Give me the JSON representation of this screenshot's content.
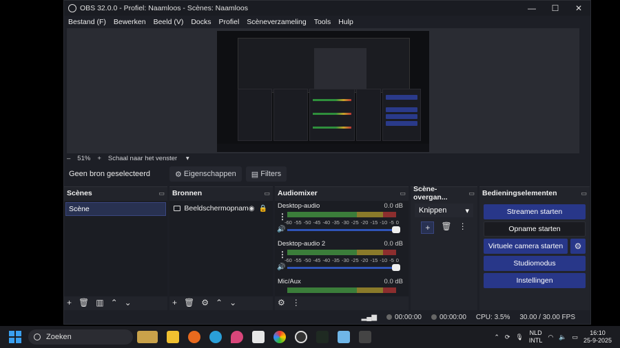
{
  "window": {
    "title": "OBS 32.0.0 - Profiel: Naamloos - Scènes: Naamloos"
  },
  "menu": [
    "Bestand (F)",
    "Bewerken",
    "Beeld (V)",
    "Docks",
    "Profiel",
    "Scèneverzameling",
    "Tools",
    "Hulp"
  ],
  "zoom": {
    "minus": "–",
    "value": "51%",
    "plus": "+",
    "mode": "Schaal naar het venster"
  },
  "context": {
    "no_source": "Geen bron geselecteerd",
    "properties": "Eigenschappen",
    "filters": "Filters"
  },
  "docks": {
    "scenes": {
      "title": "Scènes",
      "items": [
        "Scène"
      ]
    },
    "sources": {
      "title": "Bronnen",
      "items": [
        "Beeldschermopnam"
      ]
    },
    "mixer": {
      "title": "Audiomixer",
      "channels": [
        {
          "name": "Desktop-audio",
          "db": "0.0 dB"
        },
        {
          "name": "Desktop-audio 2",
          "db": "0.0 dB"
        },
        {
          "name": "Mic/Aux",
          "db": "0.0 dB"
        }
      ],
      "ticks": [
        "-60",
        "-55",
        "-50",
        "-45",
        "-40",
        "-35",
        "-30",
        "-25",
        "-20",
        "-15",
        "-10",
        "-5",
        "0"
      ]
    },
    "transitions": {
      "title": "Scène-overgan...",
      "selected": "Knippen"
    },
    "controls": {
      "title": "Bedieningselementen",
      "stream": "Streamen starten",
      "record": "Opname starten",
      "virtualcam": "Virtuele camera starten",
      "studio": "Studiomodus",
      "settings": "Instellingen"
    }
  },
  "status": {
    "rec_time": "00:00:00",
    "stream_time": "00:00:00",
    "cpu": "CPU: 3.5%",
    "fps": "30.00 / 30.00 FPS"
  },
  "taskbar": {
    "search": "Zoeken",
    "lang_top": "NLD",
    "lang_bottom": "INTL",
    "time": "16:10",
    "date": "25-9-2025"
  }
}
